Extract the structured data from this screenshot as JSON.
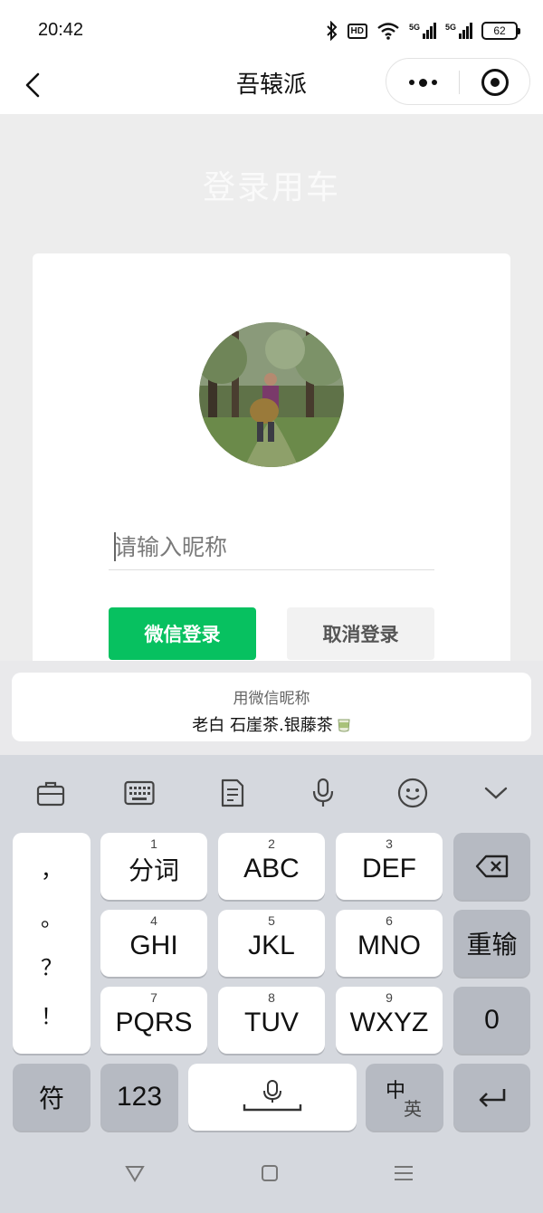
{
  "status_bar": {
    "time": "20:42",
    "hd_label": "HD",
    "sim1_label": "5G",
    "sim2_label": "5G",
    "battery_level": "62"
  },
  "nav": {
    "title": "吾辕派",
    "icons": [
      "back-arrow-icon",
      "more-dots-icon",
      "close-target-icon"
    ]
  },
  "page": {
    "heading": "登录用车",
    "nickname_placeholder": "请输入昵称",
    "nickname_value": "",
    "wechat_login_label": "微信登录",
    "cancel_login_label": "取消登录"
  },
  "suggestion": {
    "title": "用微信昵称",
    "value": "老白 石崖茶.银藤茶"
  },
  "keyboard": {
    "toolbar_icons": [
      "toolbox-icon",
      "keyboard-icon",
      "clipboard-icon",
      "microphone-icon",
      "emoji-icon",
      "collapse-keyboard-icon"
    ],
    "punctuation": [
      "，",
      "。",
      "？",
      "！"
    ],
    "keys": [
      {
        "num": "1",
        "label": "分词"
      },
      {
        "num": "2",
        "label": "ABC"
      },
      {
        "num": "3",
        "label": "DEF"
      },
      {
        "num": "4",
        "label": "GHI"
      },
      {
        "num": "5",
        "label": "JKL"
      },
      {
        "num": "6",
        "label": "MNO"
      },
      {
        "num": "7",
        "label": "PQRS"
      },
      {
        "num": "8",
        "label": "TUV"
      },
      {
        "num": "9",
        "label": "WXYZ"
      }
    ],
    "reinput_label": "重输",
    "zero_label": "0",
    "symbol_label": "符",
    "numeric_label": "123",
    "lang_zh": "中",
    "lang_en": "英"
  },
  "system_nav": {
    "icons": [
      "back-triangle-icon",
      "home-square-icon",
      "menu-lines-icon"
    ]
  },
  "colors": {
    "primary_green": "#07c160",
    "page_background": "#ededed",
    "keyboard_background": "#d5d8de"
  }
}
